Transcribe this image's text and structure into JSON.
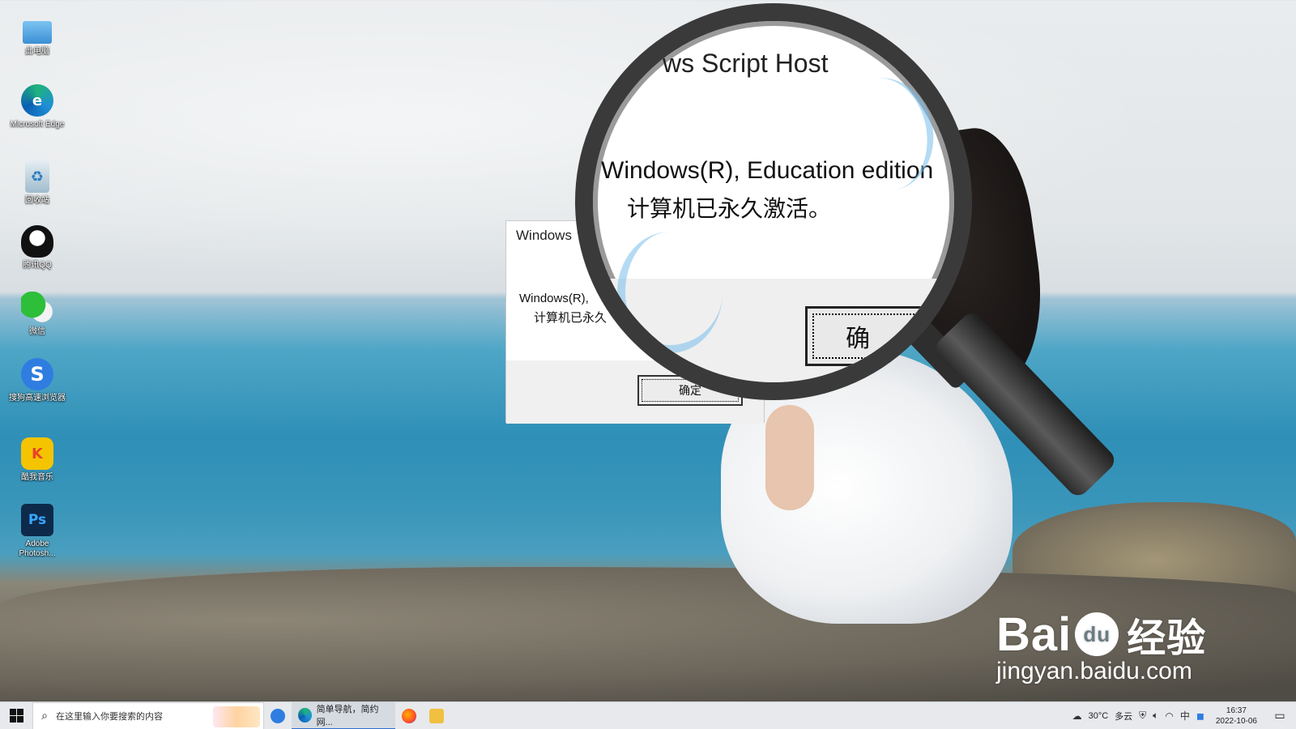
{
  "desktop": {
    "icons": [
      {
        "label": "此电脑",
        "icon": "computer-icon",
        "color": "#4aa3e0"
      },
      {
        "label": "Microsoft Edge",
        "icon": "edge-icon",
        "color": "#1f8fd6"
      },
      {
        "label": "回收站",
        "icon": "recycle-bin-icon",
        "color": "#8fb5cc"
      },
      {
        "label": "腾讯QQ",
        "icon": "qq-icon",
        "color": "#111111"
      },
      {
        "label": "微信",
        "icon": "wechat-icon",
        "color": "#2dbe3a"
      },
      {
        "label": "搜狗高速浏览器",
        "icon": "sogou-browser-icon",
        "color": "#2f7de0"
      },
      {
        "label": "酷我音乐",
        "icon": "kuwo-music-icon",
        "color": "#f5b400"
      },
      {
        "label": "Adobe Photosh...",
        "icon": "photoshop-icon",
        "color": "#0d2a4a"
      }
    ]
  },
  "dialog": {
    "title": "Windows",
    "message_line1": "Windows(R),",
    "message_line2": "计算机已永久",
    "ok_label": "确定"
  },
  "magnifier": {
    "title": "ws Script Host",
    "line1": "Windows(R), Education edition",
    "line2": "计算机已永久激活。",
    "ok_label": "确"
  },
  "watermark": {
    "brand_left": "Bai",
    "brand_paw": "du",
    "brand_cn": "经验",
    "url": "jingyan.baidu.com"
  },
  "taskbar": {
    "search_placeholder": "在这里输入你要搜索的内容",
    "active_app_label": "简单导航，简约网...",
    "weather": "30°C",
    "weather_desc": "多云",
    "time": "16:37",
    "date": "2022-10-06",
    "ime": "中"
  }
}
